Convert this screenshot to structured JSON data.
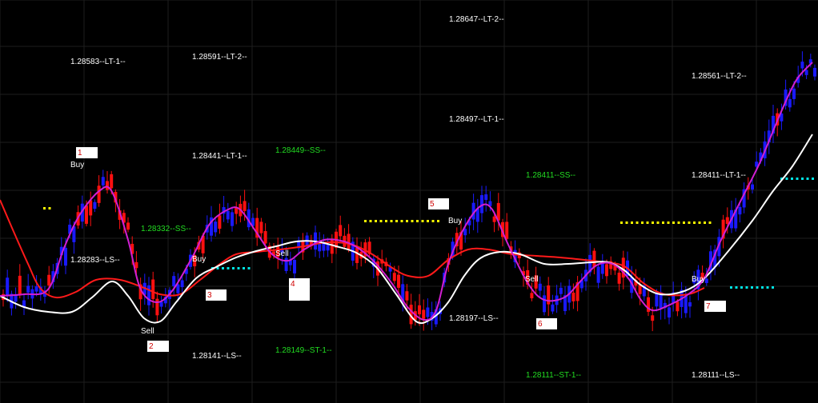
{
  "chart_data": {
    "type": "candlestick",
    "title": "",
    "xlabel": "",
    "ylabel": "",
    "grid": true,
    "colors": {
      "background": "#000000",
      "grid": "#1e1e1e",
      "bull_candle": "#1a1aff",
      "bear_candle": "#ff1010",
      "smooth_fast": "#d21fd2",
      "smooth_slow": "#ffffff",
      "smooth_red": "#ff1a1a",
      "dots_yellow": "#ffff00",
      "dots_cyan": "#00e5e5",
      "label_white": "#ffffff",
      "label_green": "#22dd22",
      "box_number": "#d00000"
    },
    "level_labels": [
      {
        "text": "1.28647--LT-2--",
        "tone": "white"
      },
      {
        "text": "1.28583--LT-1--",
        "tone": "white"
      },
      {
        "text": "1.28591--LT-2--",
        "tone": "white"
      },
      {
        "text": "1.28561--LT-2--",
        "tone": "white"
      },
      {
        "text": "1.28497--LT-1--",
        "tone": "white"
      },
      {
        "text": "1.28441--LT-1--",
        "tone": "white"
      },
      {
        "text": "1.28449--SS--",
        "tone": "green"
      },
      {
        "text": "1.28411--SS--",
        "tone": "green"
      },
      {
        "text": "1.28411--LT-1--",
        "tone": "white"
      },
      {
        "text": "1.28332--SS--",
        "tone": "green"
      },
      {
        "text": "1.28283--LS--",
        "tone": "white"
      },
      {
        "text": "1.28197--LS--",
        "tone": "white"
      },
      {
        "text": "1.28141--LS--",
        "tone": "white"
      },
      {
        "text": "1.28149--ST-1--",
        "tone": "green"
      },
      {
        "text": "1.28111--ST-1--",
        "tone": "green"
      },
      {
        "text": "1.28111--LS--",
        "tone": "white"
      }
    ],
    "signals": [
      "Buy",
      "Sell",
      "Buy",
      "Sell",
      "Buy",
      "Sell",
      "Buy"
    ],
    "boxes": [
      "1",
      "2",
      "3",
      "4",
      "5",
      "6",
      "7"
    ]
  }
}
